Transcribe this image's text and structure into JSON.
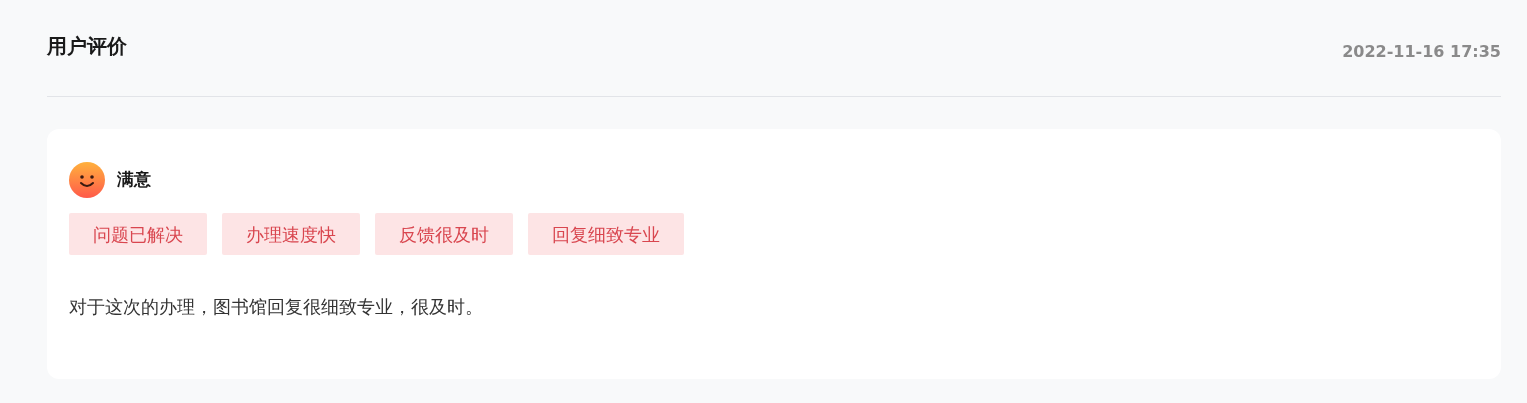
{
  "header": {
    "title": "用户评价",
    "timestamp": "2022-11-16 17:35"
  },
  "review": {
    "rating": "满意",
    "tags": [
      "问题已解决",
      "办理速度快",
      "反馈很及时",
      "回复细致专业"
    ],
    "comment": "对于这次的办理，图书馆回复很细致专业，很及时。"
  }
}
